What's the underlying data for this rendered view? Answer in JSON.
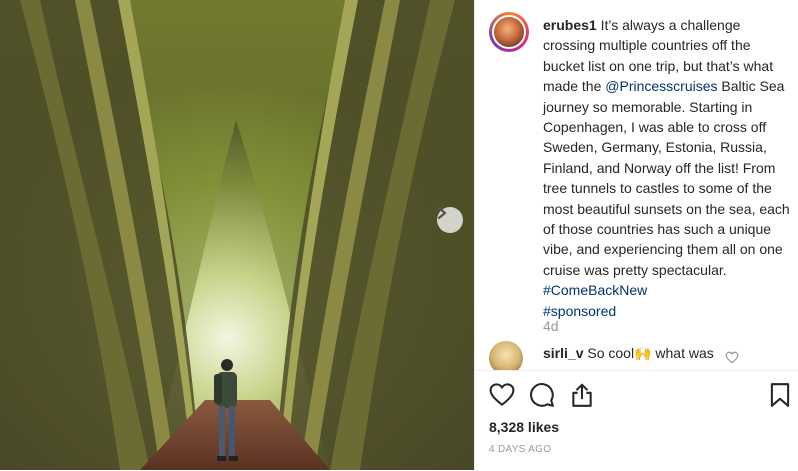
{
  "post": {
    "username": "erubes1",
    "caption_parts": {
      "p1": " It’s always a challenge crossing multiple countries off the bucket list on one trip, but that’s what made the ",
      "mention": "@Princesscruises",
      "p2": " Baltic Sea journey so memorable. Starting in Copenhagen, I was able to cross off Sweden, Germany, Estonia, Russia, Finland, and Norway off the list! From tree tunnels to castles to some of the most beautiful sunsets on the sea, each of those countries has such a unique vibe, and experiencing them all on one cruise was pretty spectacular. ",
      "hashtag1": "#ComeBackNew",
      "hashtag2": "#sponsored"
    },
    "time_ago": "4d",
    "likes": "8,328 likes",
    "date": "4 DAYS AGO"
  },
  "comment": {
    "username": "sirli_v",
    "text": " So cool🙌 what was"
  },
  "icons": {
    "next": "chevron-right-icon",
    "like": "heart-icon",
    "comment": "comment-bubble-icon",
    "share": "share-icon",
    "save": "bookmark-icon",
    "comment_like": "small-heart-icon"
  },
  "colors": {
    "link": "#003569",
    "muted": "#999999",
    "text": "#262626"
  }
}
